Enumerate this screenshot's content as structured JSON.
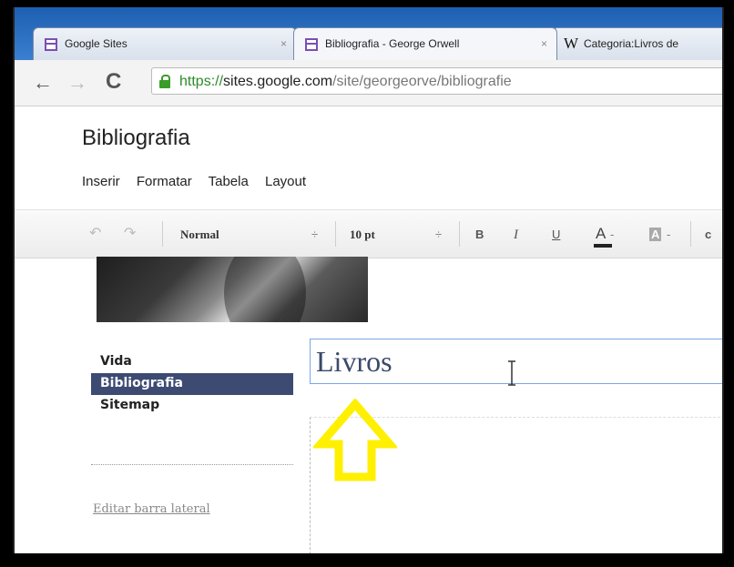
{
  "browser": {
    "tabs": [
      {
        "label": "Google Sites",
        "close": "×",
        "favicon": "google-sites-icon"
      },
      {
        "label": "Bibliografia - George Orwell",
        "close": "×",
        "favicon": "google-sites-icon",
        "active": true
      },
      {
        "label": "Categoria:Livros de",
        "favicon": "wikipedia-icon",
        "favicon_text": "W"
      }
    ],
    "url": {
      "scheme": "https://",
      "host": "sites.google.com",
      "path": "/site/georgeorve/bibliografie"
    }
  },
  "page": {
    "title": "Bibliografia",
    "menu": [
      "Inserir",
      "Formatar",
      "Tabela",
      "Layout"
    ]
  },
  "editor_toolbar": {
    "style_select": "Normal",
    "size_select": "10 pt",
    "bold": "B",
    "italic": "I",
    "underline": "U",
    "text_color": "A",
    "highlight": "A",
    "stepper": "÷",
    "truncated": "c"
  },
  "sidebar": {
    "items": [
      {
        "label": "Vida",
        "selected": false
      },
      {
        "label": "Bibliografia",
        "selected": true
      },
      {
        "label": "Sitemap",
        "selected": false
      }
    ],
    "edit_link": "Editar barra lateral"
  },
  "editor": {
    "title_value": "Livros"
  },
  "colors": {
    "tabbar_blue": "#1d5fb0",
    "sidebar_selected": "#3d4b73",
    "arrow_yellow": "#ffef00",
    "url_green": "#2d8a2a"
  }
}
